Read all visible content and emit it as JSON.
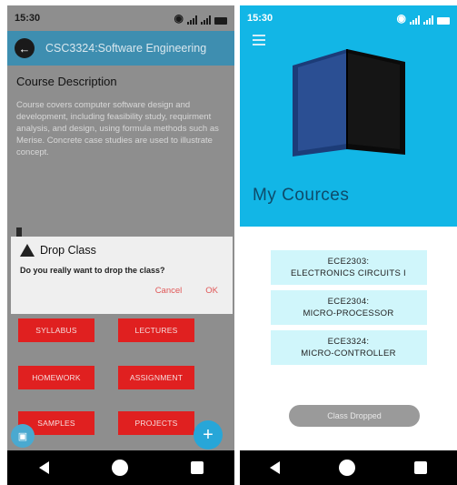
{
  "left": {
    "status": {
      "time": "15:30"
    },
    "appbar": {
      "title": "CSC3324:Software Engineering"
    },
    "course_description": {
      "heading": "Course Description",
      "text": "Course covers computer software design and development, including feasibility study, requirment analysis, and design, using formula methods such as Merise. Concrete case studies are used to illustrate concept."
    },
    "dialog": {
      "title": "Drop Class",
      "message": "Do you really want to drop the class?",
      "cancel_label": "Cancel",
      "ok_label": "OK"
    },
    "buttons": {
      "syllabus": "SYLLABUS",
      "lectures": "LECTURES",
      "homework": "HOMEWORK",
      "assignment": "ASSIGNMENT",
      "samples": "SAMPLES",
      "projects": "PROJECTS"
    },
    "fab_label": "+"
  },
  "right": {
    "status": {
      "time": "15:30"
    },
    "title": "My Cources",
    "courses": [
      {
        "code": "ECE2303:",
        "name": "ELECTRONICS CIRCUITS I"
      },
      {
        "code": "ECE2304:",
        "name": "MICRO-PROCESSOR"
      },
      {
        "code": "ECE3324:",
        "name": "MICRO-CONTROLLER"
      }
    ],
    "toast": "Class Dropped"
  },
  "colors": {
    "accent": "#12b6e6",
    "appbar": "#3e8eb0",
    "button_red": "#e02020",
    "card_bg": "#d0f6fb"
  },
  "icons": [
    "back-arrow-icon",
    "wifi-icon",
    "signal-icon",
    "battery-icon",
    "warning-icon",
    "plus-icon",
    "menu-icon",
    "book-icon",
    "nav-back-icon",
    "nav-home-icon",
    "nav-recent-icon"
  ]
}
